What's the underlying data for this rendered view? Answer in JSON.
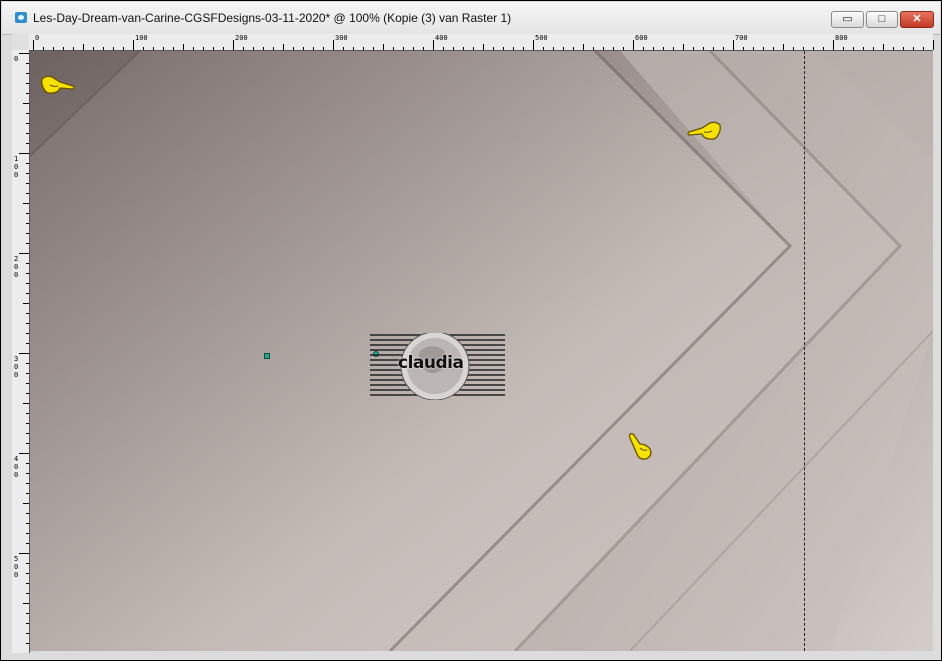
{
  "window": {
    "title": "Les-Day-Dream-van-Carine-CGSFDesigns-03-11-2020* @ 100% (Kopie (3) van Raster 1)",
    "icon": "paintshop-app-icon",
    "controls": {
      "minimize": "▭",
      "maximize": "□",
      "close": "✕"
    }
  },
  "ruler": {
    "top_labels": [
      "0",
      "100",
      "200",
      "300",
      "400",
      "500",
      "600",
      "700",
      "800"
    ],
    "left_labels": [
      "0",
      "100",
      "200",
      "300",
      "400",
      "500"
    ]
  },
  "canvas": {
    "zoom": "100%",
    "colors": {
      "dark": "#6e6260",
      "mid": "#a89e9b",
      "light": "#d2ccc8"
    }
  },
  "pointers": {
    "icon": "pointing-hand-icon",
    "color": "#f5e200"
  },
  "watermark": {
    "text": "claudia"
  }
}
